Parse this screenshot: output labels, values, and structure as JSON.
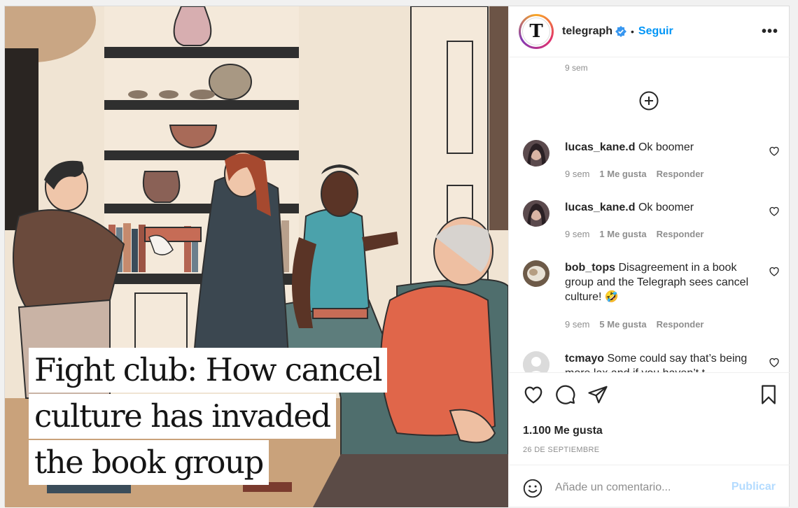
{
  "post": {
    "headline_lines": [
      "Fight club: How cancel",
      "culture has invaded",
      "the book group"
    ]
  },
  "header": {
    "avatar_letter": "T",
    "username": "telegraph",
    "separator": "•",
    "follow_label": "Seguir",
    "more_label": "•••"
  },
  "comments": {
    "top_timestamp": "9 sem",
    "items": [
      {
        "user": "lucas_kane.d",
        "text": "Ok boomer",
        "time": "9 sem",
        "likes": "1 Me gusta",
        "reply": "Responder"
      },
      {
        "user": "lucas_kane.d",
        "text": "Ok boomer",
        "time": "9 sem",
        "likes": "1 Me gusta",
        "reply": "Responder"
      },
      {
        "user": "bob_tops",
        "text": "Disagreement in a book group and the Telegraph sees cancel culture!",
        "emoji": "🤣",
        "time": "9 sem",
        "likes": "5 Me gusta",
        "reply": "Responder"
      },
      {
        "user": "tcmayo",
        "text": "Some could say that’s being more lax and if you haven’t t",
        "time": "",
        "likes": "",
        "reply": ""
      }
    ]
  },
  "actions": {
    "likes_count": "1.100 Me gusta",
    "date": "26 DE SEPTIEMBRE"
  },
  "compose": {
    "placeholder": "Añade un comentario...",
    "publish_label": "Publicar"
  },
  "colors": {
    "link_blue": "#0095f6",
    "publish_disabled": "#b3dbff",
    "muted": "#8e8e8e"
  }
}
